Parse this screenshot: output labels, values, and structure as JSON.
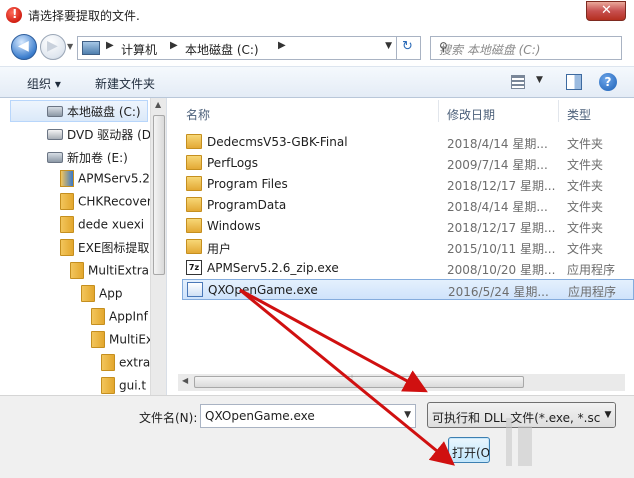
{
  "window": {
    "title": "请选择要提取的文件.",
    "close_label": "✕"
  },
  "address": {
    "crumbs": [
      "计算机",
      "本地磁盘 (C:)"
    ],
    "search_placeholder": "搜索 本地磁盘 (C:)"
  },
  "toolbar": {
    "organize_label": "组织 ▾",
    "new_folder_label": "新建文件夹"
  },
  "nav": {
    "items": [
      {
        "label": "本地磁盘 (C:)",
        "icon": "drive-icon"
      },
      {
        "label": "DVD 驱动器 (D",
        "icon": "dvd-drive-icon"
      },
      {
        "label": "新加卷 (E:)",
        "icon": "drive-icon"
      },
      {
        "label": "APMServ5.2",
        "icon": "folder-icon"
      },
      {
        "label": "CHKRecover",
        "icon": "folder-icon"
      },
      {
        "label": "dede xuexi",
        "icon": "folder-icon"
      },
      {
        "label": "EXE图标提取",
        "icon": "folder-icon"
      },
      {
        "label": "MultiExtra",
        "icon": "folder-icon"
      },
      {
        "label": "App",
        "icon": "folder-icon"
      },
      {
        "label": "AppInf",
        "icon": "folder-icon"
      },
      {
        "label": "MultiEx",
        "icon": "folder-icon"
      },
      {
        "label": "extra",
        "icon": "folder-icon"
      },
      {
        "label": "gui.t",
        "icon": "folder-icon"
      }
    ]
  },
  "filelist": {
    "columns": {
      "name": "名称",
      "date": "修改日期",
      "type": "类型"
    },
    "rows": [
      {
        "name": "DedecmsV53-GBK-Final",
        "date": "2018/4/14 星期...",
        "type": "文件夹",
        "icon": "folder-icon"
      },
      {
        "name": "PerfLogs",
        "date": "2009/7/14 星期...",
        "type": "文件夹",
        "icon": "folder-icon"
      },
      {
        "name": "Program Files",
        "date": "2018/12/17 星期...",
        "type": "文件夹",
        "icon": "folder-icon"
      },
      {
        "name": "ProgramData",
        "date": "2018/4/14 星期...",
        "type": "文件夹",
        "icon": "folder-icon"
      },
      {
        "name": "Windows",
        "date": "2018/12/17 星期...",
        "type": "文件夹",
        "icon": "folder-icon"
      },
      {
        "name": "用户",
        "date": "2015/10/11 星期...",
        "type": "文件夹",
        "icon": "folder-icon"
      },
      {
        "name": "APMServ5.2.6_zip.exe",
        "date": "2008/10/20 星期...",
        "type": "应用程序",
        "icon": "7z-archive-icon"
      },
      {
        "name": "QXOpenGame.exe",
        "date": "2016/5/24 星期...",
        "type": "应用程序",
        "icon": "exe-icon",
        "selected": true
      }
    ]
  },
  "bottom": {
    "filename_label": "文件名(N):",
    "filename_value": "QXOpenGame.exe",
    "filter_label": "可执行和 DLL 文件(*.exe, *.scr",
    "open_label": "打开(O)"
  },
  "colors": {
    "selection": "#cfe3fb",
    "arrow": "#d01010",
    "close_button": "#c75050"
  }
}
